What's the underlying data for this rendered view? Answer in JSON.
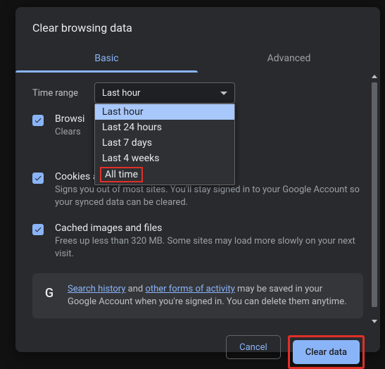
{
  "dialog": {
    "title": "Clear browsing data",
    "tabs": {
      "basic": "Basic",
      "advanced": "Advanced"
    },
    "time_range_label": "Time range",
    "select_value": "Last hour",
    "dropdown": [
      "Last hour",
      "Last 24 hours",
      "Last 7 days",
      "Last 4 weeks",
      "All time"
    ],
    "items": [
      {
        "title": "Browsing history",
        "title_cut": "Browsi",
        "desc": "Clears history and autocompletions in the address bar.",
        "desc_cut": "Clears"
      },
      {
        "title": "Cookies and other site data",
        "desc": "Signs you out of most sites. You'll stay signed in to your Google Account so your synced data can be cleared."
      },
      {
        "title": "Cached images and files",
        "desc": "Frees up less than 320 MB. Some sites may load more slowly on your next visit."
      }
    ],
    "note": {
      "pre": "",
      "link1": "Search history",
      "mid": " and ",
      "link2": "other forms of activity",
      "post": " may be saved in your Google Account when you're signed in. You can delete them anytime."
    },
    "buttons": {
      "cancel": "Cancel",
      "clear": "Clear data"
    }
  }
}
